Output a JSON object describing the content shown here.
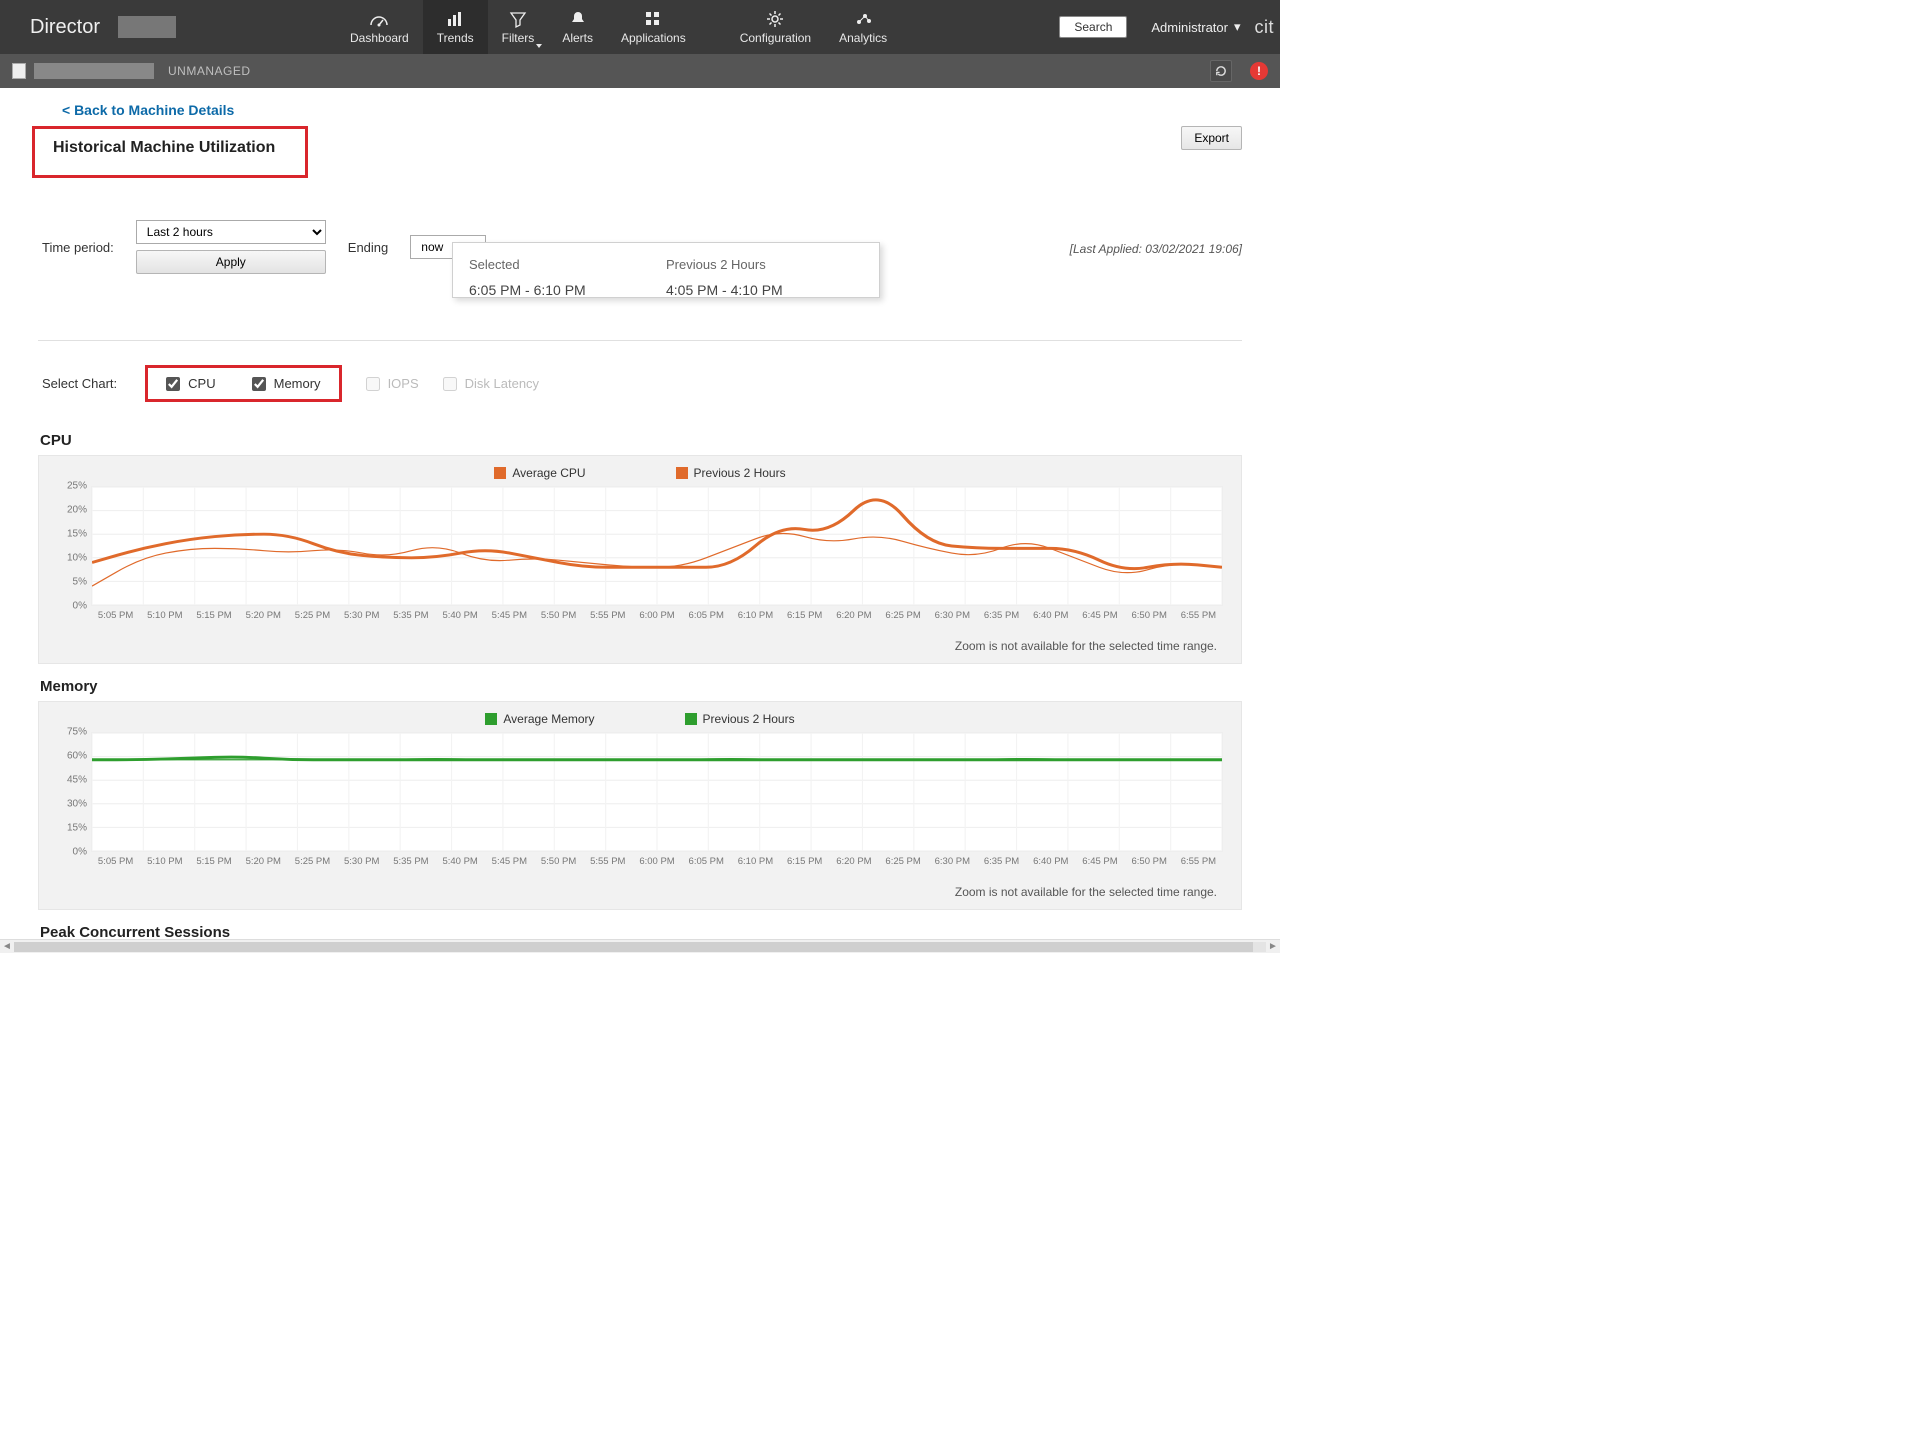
{
  "brand": "Director",
  "brand_right": "cit",
  "nav": {
    "dashboard": "Dashboard",
    "trends": "Trends",
    "filters": "Filters",
    "alerts": "Alerts",
    "applications": "Applications",
    "configuration": "Configuration",
    "analytics": "Analytics"
  },
  "search_label": "Search",
  "admin_label": "Administrator",
  "subbar": {
    "status": "UNMANAGED",
    "alert_badge": "!"
  },
  "back_link": "< Back to Machine Details",
  "page_title": "Historical Machine Utilization",
  "export_label": "Export",
  "time_period_label": "Time period:",
  "time_period_value": "Last 2 hours",
  "ending_label": "Ending",
  "ending_value": "now",
  "apply_label": "Apply",
  "last_applied": "[Last Applied: 03/02/2021 19:06]",
  "popup": {
    "selected_h": "Selected",
    "selected_v": "6:05 PM - 6:10 PM",
    "prev_h": "Previous 2 Hours",
    "prev_v": "4:05 PM - 4:10 PM"
  },
  "select_chart_label": "Select Chart:",
  "chk_cpu": "CPU",
  "chk_memory": "Memory",
  "chk_iops": "IOPS",
  "chk_disk": "Disk Latency",
  "cpu": {
    "title": "CPU",
    "legend_avg": "Average CPU",
    "legend_prev": "Previous 2 Hours",
    "zoom": "Zoom is not available for the selected time range."
  },
  "memory": {
    "title": "Memory",
    "legend_avg": "Average Memory",
    "legend_prev": "Previous 2 Hours",
    "zoom": "Zoom is not available for the selected time range."
  },
  "sessions_title": "Peak Concurrent Sessions",
  "chart_data": [
    {
      "type": "line",
      "title": "CPU",
      "ylabel": "%",
      "ylim": [
        0,
        25
      ],
      "yticks": [
        "0%",
        "5%",
        "10%",
        "15%",
        "20%",
        "25%"
      ],
      "categories": [
        "5:05 PM",
        "5:10 PM",
        "5:15 PM",
        "5:20 PM",
        "5:25 PM",
        "5:30 PM",
        "5:35 PM",
        "5:40 PM",
        "5:45 PM",
        "5:50 PM",
        "5:55 PM",
        "6:00 PM",
        "6:05 PM",
        "6:10 PM",
        "6:15 PM",
        "6:20 PM",
        "6:25 PM",
        "6:30 PM",
        "6:35 PM",
        "6:40 PM",
        "6:45 PM",
        "6:50 PM",
        "6:55 PM"
      ],
      "series": [
        {
          "name": "Average CPU",
          "color": "#e06a2b",
          "values": [
            9,
            12,
            14,
            15,
            15,
            11,
            10,
            10,
            12,
            10,
            8,
            8,
            8,
            8,
            17,
            15,
            25,
            13,
            12,
            12,
            12,
            7,
            9,
            8
          ]
        },
        {
          "name": "Previous 2 Hours",
          "color": "#e06a2b",
          "values": [
            4,
            10,
            12,
            12,
            11,
            12,
            10,
            13,
            9,
            10,
            9,
            8,
            8,
            12,
            16,
            13,
            15,
            12,
            10,
            14,
            10,
            6,
            9,
            8
          ]
        }
      ]
    },
    {
      "type": "line",
      "title": "Memory",
      "ylabel": "%",
      "ylim": [
        0,
        75
      ],
      "yticks": [
        "0%",
        "15%",
        "30%",
        "45%",
        "60%",
        "75%"
      ],
      "categories": [
        "5:05 PM",
        "5:10 PM",
        "5:15 PM",
        "5:20 PM",
        "5:25 PM",
        "5:30 PM",
        "5:35 PM",
        "5:40 PM",
        "5:45 PM",
        "5:50 PM",
        "5:55 PM",
        "6:00 PM",
        "6:05 PM",
        "6:10 PM",
        "6:15 PM",
        "6:20 PM",
        "6:25 PM",
        "6:30 PM",
        "6:35 PM",
        "6:40 PM",
        "6:45 PM",
        "6:50 PM",
        "6:55 PM"
      ],
      "series": [
        {
          "name": "Average Memory",
          "color": "#2e9e2e",
          "values": [
            58,
            58,
            59,
            60,
            58,
            58,
            58,
            58,
            58,
            58,
            58,
            58,
            58,
            58,
            58,
            58,
            58,
            58,
            58,
            58,
            58,
            58,
            58,
            58
          ]
        },
        {
          "name": "Previous 2 Hours",
          "color": "#2e9e2e",
          "values": [
            58,
            58,
            58,
            58,
            58,
            58,
            58,
            59,
            58,
            58,
            58,
            58,
            58,
            59,
            58,
            58,
            58,
            58,
            58,
            59,
            58,
            58,
            58,
            58
          ]
        }
      ]
    }
  ]
}
